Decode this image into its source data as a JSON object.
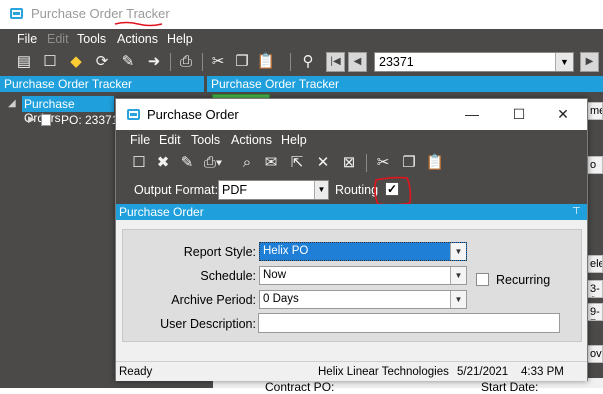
{
  "app": {
    "title": "Purchase Order Tracker",
    "menu": [
      "File",
      "Edit",
      "Tools",
      "Actions",
      "Help"
    ],
    "record_number": "23371"
  },
  "left_panel": {
    "header": "Purchase Order Tracker",
    "tree_root": "Purchase Orders",
    "tree_child": "PO: 23371"
  },
  "right_panel": {
    "header": "Purchase Order Tracker",
    "peek_texts": [
      "me",
      "o",
      "ele",
      "3-0",
      "9-7",
      "ove"
    ],
    "contract_po_label": "Contract PO:",
    "start_date_label": "Start Date:"
  },
  "dialog": {
    "title": "Purchase Order",
    "menu": [
      "File",
      "Edit",
      "Tools",
      "Actions",
      "Help"
    ],
    "output_format_label": "Output Format:",
    "output_format_value": "PDF",
    "routing_label": "Routing",
    "routing_checked": true,
    "section_title": "Purchase Order",
    "form": {
      "report_style_label": "Report Style:",
      "report_style_value": "Helix PO",
      "schedule_label": "Schedule:",
      "schedule_value": "Now",
      "recurring_label": "Recurring",
      "archive_label": "Archive Period:",
      "archive_value": "0 Days",
      "description_label": "User Description:",
      "description_value": ""
    },
    "status": {
      "text": "Ready",
      "company": "Helix Linear Technologies",
      "date": "5/21/2021",
      "time": "4:33 PM"
    }
  },
  "colors": {
    "accent": "#1fa0dc",
    "dark_chrome": "#4b4a48",
    "selection": "#1f7fd6",
    "annotation_red": "#e0141e"
  }
}
